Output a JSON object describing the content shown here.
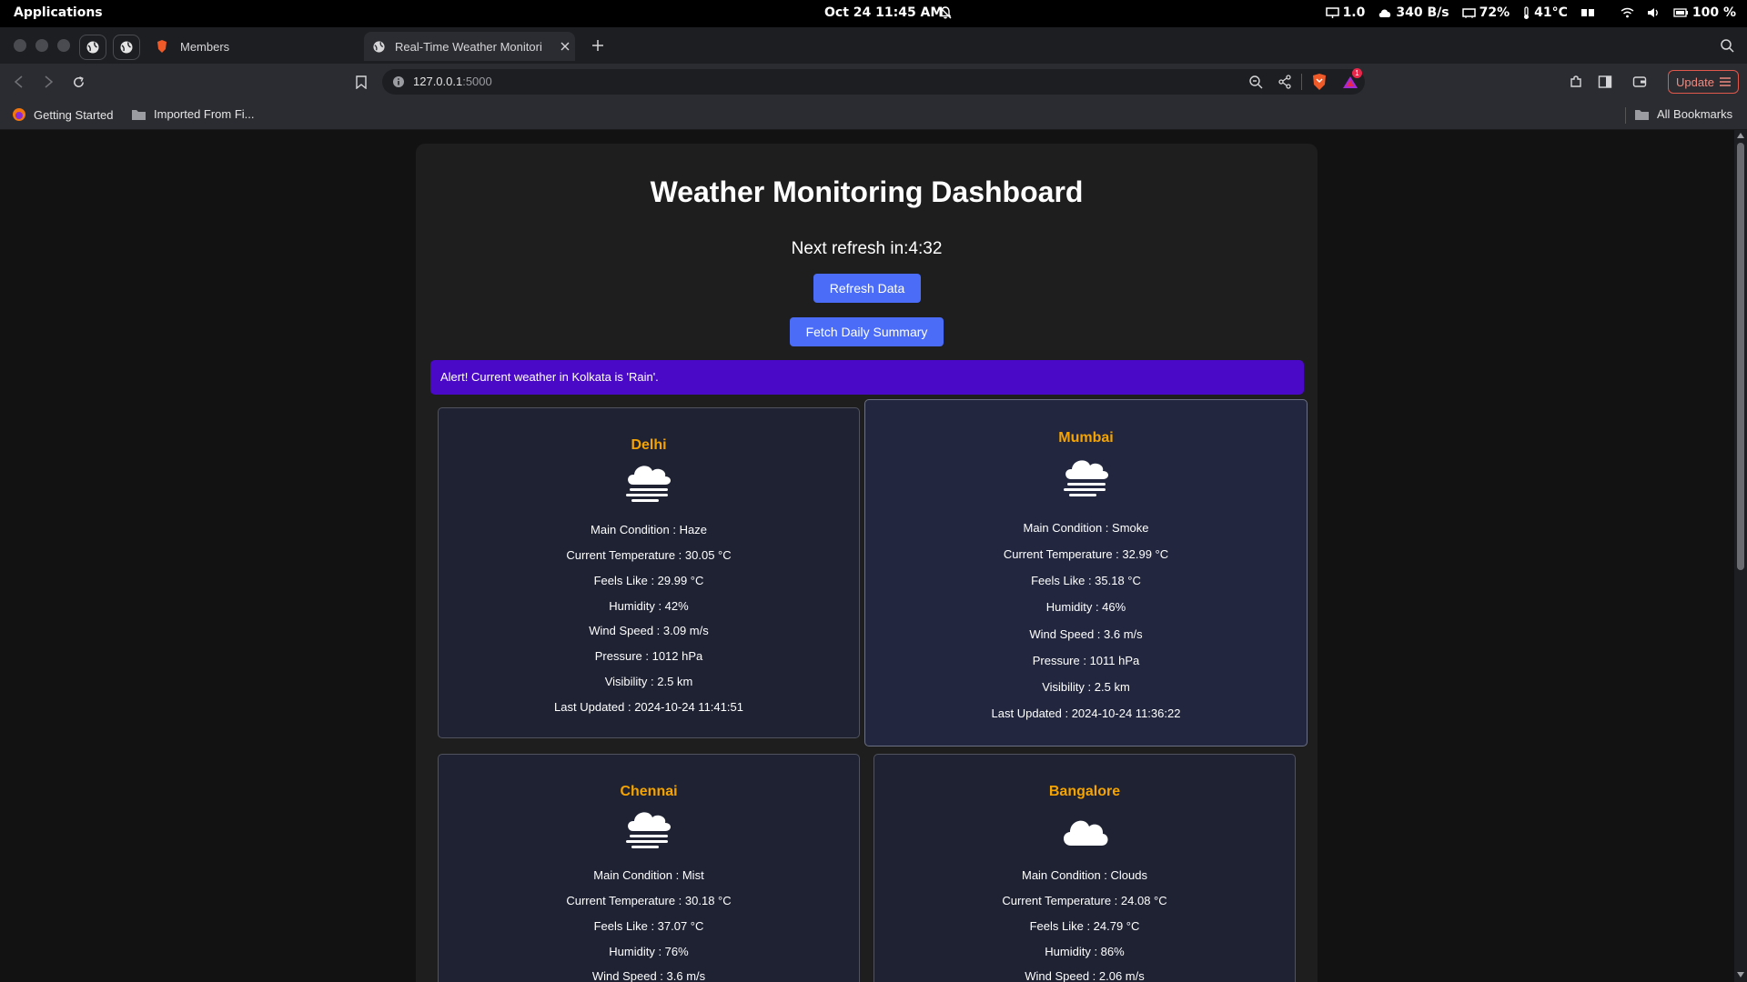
{
  "system": {
    "apps_label": "Applications",
    "clock": "Oct 24  11:45 AM",
    "monitor": "1.0",
    "network": "340 B/s",
    "memory": "72%",
    "temperature": "41°C",
    "battery": "100 %"
  },
  "browser": {
    "tabs": [
      {
        "label": "Members",
        "icon": "brave-icon"
      },
      {
        "label": "Real-Time Weather Monitori",
        "icon": "globe-icon"
      }
    ],
    "url_host": "127.0.0.1",
    "url_port": ":5000",
    "update_label": "Update",
    "shield_badge": "1",
    "bookmarks": [
      {
        "label": "Getting Started"
      },
      {
        "label": "Imported From Fi..."
      }
    ],
    "all_bookmarks": "All Bookmarks"
  },
  "page": {
    "title": "Weather Monitoring Dashboard",
    "refresh_timer": "Next refresh in:4:32",
    "refresh_button": "Refresh Data",
    "summary_button": "Fetch Daily Summary",
    "alert": "Alert! Current weather in Kolkata is 'Rain'.",
    "cities": [
      {
        "name": "Delhi",
        "icon": "haze-icon",
        "stats": [
          "Main Condition : Haze",
          "Current Temperature : 30.05 °C",
          "Feels Like : 29.99 °C",
          "Humidity : 42%",
          "Wind Speed : 3.09 m/s",
          "Pressure : 1012 hPa",
          "Visibility : 2.5 km",
          "Last Updated : 2024-10-24 11:41:51"
        ]
      },
      {
        "name": "Mumbai",
        "icon": "haze-icon",
        "stats": [
          "Main Condition : Smoke",
          "Current Temperature : 32.99 °C",
          "Feels Like : 35.18 °C",
          "Humidity : 46%",
          "Wind Speed : 3.6 m/s",
          "Pressure : 1011 hPa",
          "Visibility : 2.5 km",
          "Last Updated : 2024-10-24 11:36:22"
        ]
      },
      {
        "name": "Chennai",
        "icon": "haze-icon",
        "stats": [
          "Main Condition : Mist",
          "Current Temperature : 30.18 °C",
          "Feels Like : 37.07 °C",
          "Humidity : 76%",
          "Wind Speed : 3.6 m/s"
        ]
      },
      {
        "name": "Bangalore",
        "icon": "cloud-icon",
        "stats": [
          "Main Condition : Clouds",
          "Current Temperature : 24.08 °C",
          "Feels Like : 24.79 °C",
          "Humidity : 86%",
          "Wind Speed : 2.06 m/s"
        ]
      }
    ]
  },
  "colors": {
    "accent_button": "#4a6cf7",
    "alert_bg": "#4a09c6",
    "city_name": "#f5a300",
    "card_bg": "#1e2233"
  }
}
